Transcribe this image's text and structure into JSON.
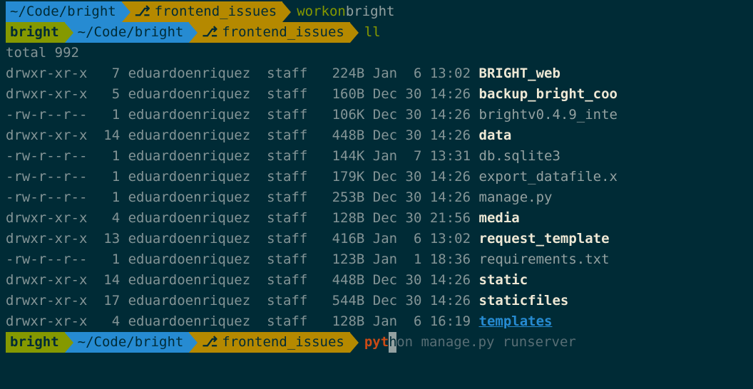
{
  "prompt1": {
    "path": " ~/Code/bright ",
    "branch": "frontend_issues ",
    "command": "workon",
    "arg": " bright"
  },
  "prompt2": {
    "venv": " bright ",
    "path": " ~/Code/bright ",
    "branch": "frontend_issues ",
    "command": "ll"
  },
  "total_line": "total 992",
  "listing": [
    {
      "perms": "drwxr-xr-x",
      "links": "   7",
      "owner": " eduardoenriquez ",
      "group": " staff ",
      "size": "  224B",
      "date": " Jan  6 13:02 ",
      "name": "BRIGHT_web",
      "style": "bold"
    },
    {
      "perms": "drwxr-xr-x",
      "links": "   5",
      "owner": " eduardoenriquez ",
      "group": " staff ",
      "size": "  160B",
      "date": " Dec 30 14:26 ",
      "name": "backup_bright_coo",
      "style": "bold"
    },
    {
      "perms": "-rw-r--r--",
      "links": "   1",
      "owner": " eduardoenriquez ",
      "group": " staff ",
      "size": "  106K",
      "date": " Dec 30 14:26 ",
      "name": "brightv0.4.9_inte",
      "style": "normal"
    },
    {
      "perms": "drwxr-xr-x",
      "links": "  14",
      "owner": " eduardoenriquez ",
      "group": " staff ",
      "size": "  448B",
      "date": " Dec 30 14:26 ",
      "name": "data",
      "style": "bold"
    },
    {
      "perms": "-rw-r--r--",
      "links": "   1",
      "owner": " eduardoenriquez ",
      "group": " staff ",
      "size": "  144K",
      "date": " Jan  7 13:31 ",
      "name": "db.sqlite3",
      "style": "normal"
    },
    {
      "perms": "-rw-r--r--",
      "links": "   1",
      "owner": " eduardoenriquez ",
      "group": " staff ",
      "size": "  179K",
      "date": " Dec 30 14:26 ",
      "name": "export_datafile.x",
      "style": "normal"
    },
    {
      "perms": "-rw-r--r--",
      "links": "   1",
      "owner": " eduardoenriquez ",
      "group": " staff ",
      "size": "  253B",
      "date": " Dec 30 14:26 ",
      "name": "manage.py",
      "style": "normal"
    },
    {
      "perms": "drwxr-xr-x",
      "links": "   4",
      "owner": " eduardoenriquez ",
      "group": " staff ",
      "size": "  128B",
      "date": " Dec 30 21:56 ",
      "name": "media",
      "style": "bold"
    },
    {
      "perms": "drwxr-xr-x",
      "links": "  13",
      "owner": " eduardoenriquez ",
      "group": " staff ",
      "size": "  416B",
      "date": " Jan  6 13:02 ",
      "name": "request_template",
      "style": "bold"
    },
    {
      "perms": "-rw-r--r--",
      "links": "   1",
      "owner": " eduardoenriquez ",
      "group": " staff ",
      "size": "  123B",
      "date": " Jan  1 18:36 ",
      "name": "requirements.txt",
      "style": "normal"
    },
    {
      "perms": "drwxr-xr-x",
      "links": "  14",
      "owner": " eduardoenriquez ",
      "group": " staff ",
      "size": "  448B",
      "date": " Dec 30 14:26 ",
      "name": "static",
      "style": "bold"
    },
    {
      "perms": "drwxr-xr-x",
      "links": "  17",
      "owner": " eduardoenriquez ",
      "group": " staff ",
      "size": "  544B",
      "date": " Dec 30 14:26 ",
      "name": "staticfiles",
      "style": "bold"
    },
    {
      "perms": "drwxr-xr-x",
      "links": "   4",
      "owner": " eduardoenriquez ",
      "group": " staff ",
      "size": "  128B",
      "date": " Jan  6 16:19 ",
      "name": "templates",
      "style": "link"
    }
  ],
  "prompt3": {
    "venv": " bright ",
    "path": " ~/Code/bright ",
    "branch": "frontend_issues ",
    "typed": "pyt",
    "cursor_char": "h",
    "suggestion": "on manage.py runserver"
  },
  "branch_glyph": "⎇"
}
